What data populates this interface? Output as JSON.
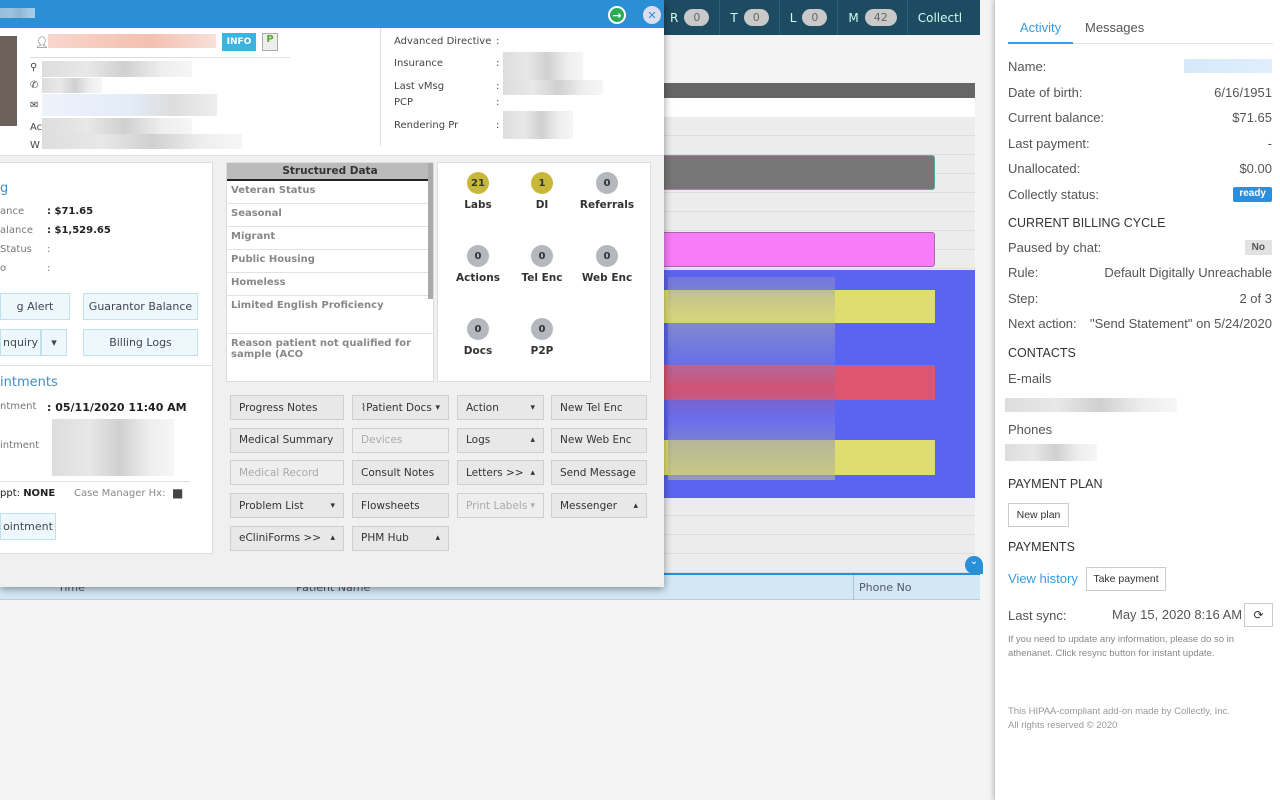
{
  "topbar": {
    "counters": [
      {
        "label": "R",
        "value": "0"
      },
      {
        "label": "T",
        "value": "0"
      },
      {
        "label": "L",
        "value": "0"
      },
      {
        "label": "M",
        "value": "42"
      }
    ],
    "collectly": "Collectl"
  },
  "grid": {
    "columns": [
      "Time",
      "Patient Name",
      "Phone No"
    ],
    "colors": {
      "gray": "#777777",
      "pink": "#f87cf8",
      "blue": "#5b64f0",
      "yellow": "#dede6e",
      "red": "#dd5570"
    }
  },
  "modal": {
    "info_button": "INFO",
    "header_labels": [
      "Ac",
      "W"
    ],
    "right_fields": [
      {
        "label": "Advanced Directive",
        "sep": ":"
      },
      {
        "label": "Insurance",
        "sep": ":"
      },
      {
        "label": "Last vMsg",
        "sep": ":"
      },
      {
        "label": "PCP",
        "sep": ":"
      },
      {
        "label": "Rendering Pr",
        "sep": ":"
      }
    ],
    "billing": {
      "title": "g",
      "rows": [
        {
          "label": "ance",
          "value": "$71.65"
        },
        {
          "label": "alance",
          "value": "$1,529.65"
        },
        {
          "label": "Status",
          "value": ""
        },
        {
          "label": "o",
          "value": ""
        }
      ],
      "buttons": {
        "alert": "g Alert",
        "guarantor": "Guarantor Balance",
        "inquiry": "nquiry",
        "logs": "Billing Logs"
      }
    },
    "appointments": {
      "title": "intments",
      "row1_label": "ntment",
      "row1_value": "05/11/2020 11:40 AM",
      "row2_label": "intment",
      "appt_label": "ppt:",
      "appt_value": "NONE",
      "case_manager": "Case Manager Hx:",
      "button": "ointment"
    },
    "structured_data": {
      "title": "Structured Data",
      "items": [
        "Veteran Status",
        "Seasonal",
        "Migrant",
        "Public Housing",
        "Homeless",
        "Limited English Proficiency",
        "Reason patient not qualified for sample (ACO"
      ]
    },
    "badges": [
      {
        "label": "Labs",
        "count": "21",
        "color": "#c7b83a"
      },
      {
        "label": "DI",
        "count": "1",
        "color": "#c7b83a"
      },
      {
        "label": "Referrals",
        "count": "0"
      },
      {
        "label": "Actions",
        "count": "0"
      },
      {
        "label": "Tel Enc",
        "count": "0"
      },
      {
        "label": "Web Enc",
        "count": "0"
      },
      {
        "label": "Docs",
        "count": "0"
      },
      {
        "label": "P2P",
        "count": "0"
      }
    ],
    "buttons": {
      "progress_notes": "Progress Notes",
      "patient_docs": "Patient Docs",
      "action": "Action",
      "new_tel_enc": "New Tel Enc",
      "medical_summary": "Medical Summary",
      "devices": "Devices",
      "logs": "Logs",
      "new_web_enc": "New Web Enc",
      "medical_record": "Medical Record",
      "consult_notes": "Consult Notes",
      "letters": "Letters  >>",
      "send_message": "Send Message",
      "problem_list": "Problem List",
      "flowsheets": "Flowsheets",
      "print_labels": "Print Labels",
      "messenger": "Messenger",
      "ecliniforms": "eCliniForms  >>",
      "phm_hub": "PHM Hub"
    }
  },
  "collectly": {
    "tabs": [
      {
        "label": "Activity",
        "active": true
      },
      {
        "label": "Messages"
      }
    ],
    "fields": [
      {
        "label": "Name:",
        "value": ""
      },
      {
        "label": "Date of birth:",
        "value": "6/16/1951"
      },
      {
        "label": "Current balance:",
        "value": "$71.65"
      },
      {
        "label": "Last payment:",
        "value": "-"
      },
      {
        "label": "Unallocated:",
        "value": "$0.00"
      },
      {
        "label": "Collectly status:",
        "value": "ready"
      }
    ],
    "billing_cycle": {
      "title": "CURRENT BILLING CYCLE",
      "paused_label": "Paused by chat:",
      "paused_value": "No",
      "rule_label": "Rule:",
      "rule_value": "Default Digitally Unreachable",
      "step_label": "Step:",
      "step_value": "2 of 3",
      "next_label": "Next action:",
      "next_value": "\"Send Statement\" on 5/24/2020"
    },
    "contacts": {
      "title": "CONTACTS",
      "emails": "E-mails",
      "phones": "Phones"
    },
    "payment_plan": {
      "title": "PAYMENT PLAN",
      "button": "New plan"
    },
    "payments": {
      "title": "PAYMENTS",
      "view_history": "View history",
      "take_payment": "Take payment"
    },
    "sync": {
      "label": "Last sync:",
      "value": "May 15, 2020 8:16 AM",
      "note": "If you need to update any information, please do so in athenanet. Click resync button for instant update."
    },
    "footer": {
      "line1": "This HIPAA-compliant add-on made by Collectly, Inc.",
      "line2": "All rights reserved © 2020"
    },
    "accent": "#3a9be0"
  }
}
